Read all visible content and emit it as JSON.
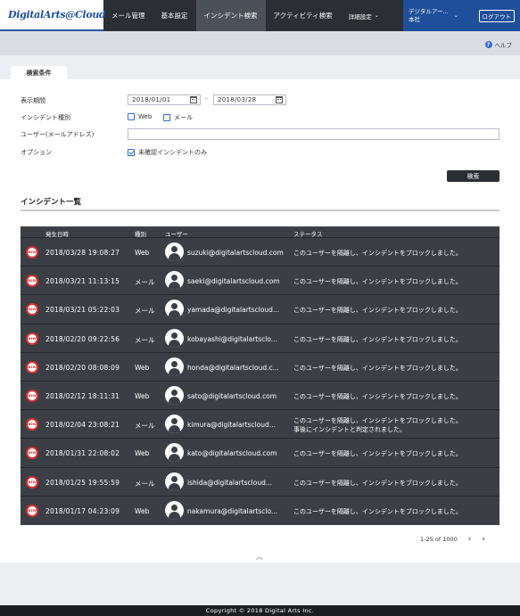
{
  "brand": {
    "logo_text": "DigitalArts@Cloud"
  },
  "nav": {
    "items": [
      {
        "label": "メール管理"
      },
      {
        "label": "基本設定"
      },
      {
        "label": "インシデント検索"
      },
      {
        "label": "アクティビティ検索"
      },
      {
        "label": "詳細設定"
      }
    ],
    "user_line1": "デジタルアー...",
    "user_line2": "本社",
    "logout_label": "ログアウト"
  },
  "help_label": "ヘルプ",
  "search": {
    "tab_label": "検索条件",
    "period_label": "表示期間",
    "date_from": "2018/01/01",
    "date_sep": "-",
    "date_to": "2018/03/28",
    "type_label": "インシデント種別",
    "type_web": "Web",
    "type_mail": "メール",
    "user_label": "ユーザー(メールアドレス)",
    "user_value": "",
    "option_label": "オプション",
    "option_unconfirmed": "未確認インシデントのみ",
    "search_button": "検索"
  },
  "incidents": {
    "title": "インシデント一覧",
    "columns": {
      "date": "発生日時",
      "type": "種別",
      "user": "ユーザー",
      "status": "ステータス"
    },
    "badge": "NEW",
    "rows": [
      {
        "date": "2018/03/28 19:08:27",
        "type": "Web",
        "user": "suzuki@digitalartscloud.com",
        "status": "このユーザーを隔離し、インシデントをブロックしました。",
        "status2": ""
      },
      {
        "date": "2018/03/21 11:13:15",
        "type": "メール",
        "user": "saeki@digitalartscloud.com",
        "status": "このユーザーを隔離し、インシデントをブロックしました。",
        "status2": ""
      },
      {
        "date": "2018/03/21 05:22:03",
        "type": "メール",
        "user": "yamada@digitalartscloud...",
        "status": "このユーザーを隔離し、インシデントをブロックしました。",
        "status2": ""
      },
      {
        "date": "2018/02/20 09:22:56",
        "type": "メール",
        "user": "kobayashi@digitalartsclo...",
        "status": "このユーザーを隔離し、インシデントをブロックしました。",
        "status2": ""
      },
      {
        "date": "2018/02/20 08:08:09",
        "type": "Web",
        "user": "honda@digitalartscloud.c...",
        "status": "このユーザーを隔離し、インシデントをブロックしました。",
        "status2": ""
      },
      {
        "date": "2018/02/12 18:11:31",
        "type": "Web",
        "user": "sato@digitalartscloud.com",
        "status": "このユーザーを隔離し、インシデントをブロックしました。",
        "status2": ""
      },
      {
        "date": "2018/02/04 23:08:21",
        "type": "メール",
        "user": "kimura@digitalartscloud...",
        "status": "このユーザーを隔離し、インシデントをブロックしました。",
        "status2": "事後にインシデントと判定されました。"
      },
      {
        "date": "2018/01/31 22:08:02",
        "type": "Web",
        "user": "kato@digitalartscloud.com",
        "status": "このユーザーを隔離し、インシデントをブロックしました。",
        "status2": ""
      },
      {
        "date": "2018/01/25 19:55:59",
        "type": "メール",
        "user": "ishida@digitalartscloud...",
        "status": "このユーザーを隔離し、インシデントをブロックしました。",
        "status2": ""
      },
      {
        "date": "2018/01/17 04:23:09",
        "type": "Web",
        "user": "nakamura@digitalartsclo...",
        "status": "このユーザーを隔離し、インシデントをブロックしました。",
        "status2": ""
      }
    ]
  },
  "pager": {
    "range": "1-25",
    "of": "of",
    "total": "1000",
    "prev": "‹",
    "next": "›"
  },
  "collapse_glyph": "︽",
  "footer": "Copyright © 2018 Digital Arts Inc."
}
